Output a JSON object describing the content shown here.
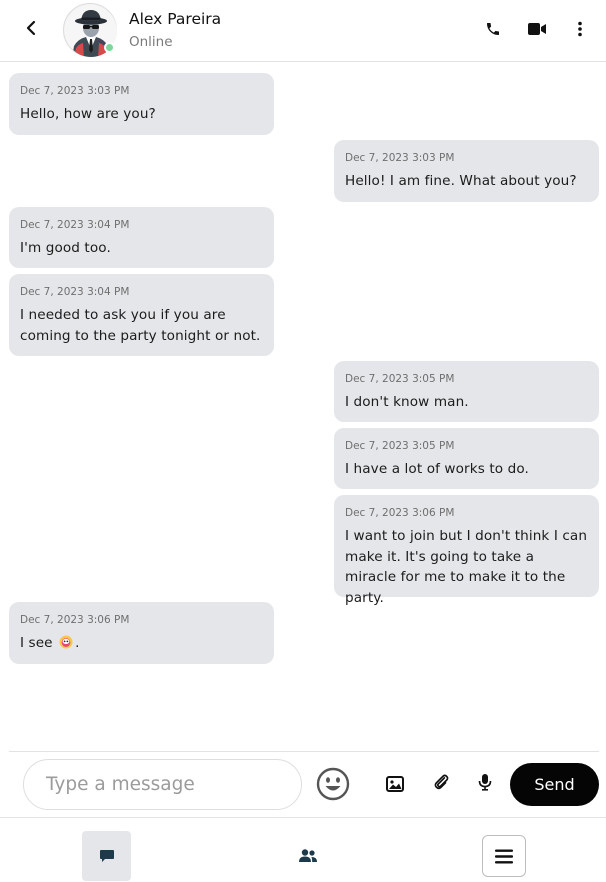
{
  "header": {
    "contact_name": "Alex Pareira",
    "contact_status": "Online",
    "icons": [
      "back-chevron-icon",
      "phone-icon",
      "video-camera-icon",
      "more-vertical-icon"
    ]
  },
  "messages": [
    {
      "direction": "received",
      "timestamp": "Dec 7, 2023 3:03 PM",
      "text": "Hello, how are you?"
    },
    {
      "direction": "sent",
      "timestamp": "Dec 7, 2023 3:03 PM",
      "text": "Hello! I am fine. What about you?"
    },
    {
      "direction": "received",
      "timestamp": "Dec 7, 2023 3:04 PM",
      "text": "I'm good too."
    },
    {
      "direction": "received",
      "timestamp": "Dec 7, 2023 3:04 PM",
      "text": "I needed to ask you if you are coming to the party tonight or not."
    },
    {
      "direction": "sent",
      "timestamp": "Dec 7, 2023 3:05 PM",
      "text": "I don't know man."
    },
    {
      "direction": "sent",
      "timestamp": "Dec 7, 2023 3:05 PM",
      "text": "I have a lot of works to do."
    },
    {
      "direction": "sent",
      "timestamp": "Dec 7, 2023 3:06 PM",
      "text": "I want to join but I don't think I can make it. It's going to take a miracle for me to make it to the party."
    },
    {
      "direction": "received",
      "timestamp": "Dec 7, 2023 3:06 PM",
      "text_before": "I see",
      "emoji": "tongue-out-emoji",
      "text_after": "."
    }
  ],
  "composer": {
    "placeholder": "Type a message",
    "send_label": "Send",
    "tools": [
      "smiley-emoji-icon",
      "image-icon",
      "paperclip-icon",
      "microphone-icon"
    ]
  },
  "bottom_nav": {
    "items": [
      "chat-bubble-icon",
      "users-icon",
      "hamburger-menu-icon"
    ],
    "active": "chat-bubble-icon"
  },
  "colors": {
    "bubble": "#e5e6e9",
    "send_button": "#050505",
    "online": "#7bd89a",
    "accent_dark": "#1c3a4a"
  }
}
